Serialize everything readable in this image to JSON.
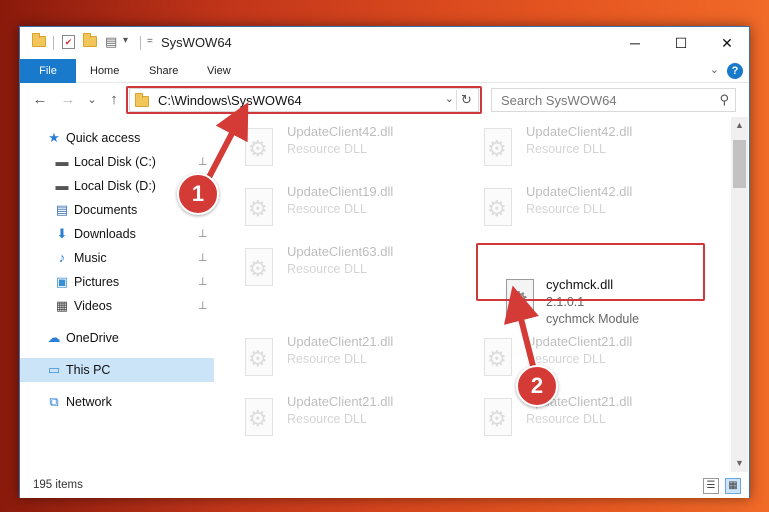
{
  "window": {
    "title": "SysWOW64",
    "minimize_glyph": "─",
    "maximize_glyph": "☐",
    "close_glyph": "✕"
  },
  "quick_access_toolbar": {
    "icons": [
      "folder-icon",
      "properties-icon",
      "new-folder-icon",
      "customize-icon"
    ],
    "dropdown_glyph": "▾"
  },
  "ribbon": {
    "tabs": [
      "File",
      "Home",
      "Share",
      "View"
    ],
    "help_glyph": "?",
    "collapse_glyph": "⌄"
  },
  "navigation": {
    "back_glyph": "←",
    "forward_glyph": "→",
    "recent_glyph": "⌄",
    "up_glyph": "↑",
    "address": "C:\\Windows\\SysWOW64",
    "address_dropdown_glyph": "⌄",
    "refresh_glyph": "↻",
    "search_placeholder": "Search SysWOW64",
    "search_glyph": "⚲"
  },
  "sidebar": {
    "items": [
      {
        "label": "Quick access",
        "icon": "star-icon",
        "glyph": "★",
        "color": "#2a7fd4",
        "pinned": false
      },
      {
        "label": "Local Disk (C:)",
        "icon": "drive-icon",
        "glyph": "▬",
        "color": "#555555",
        "pinned": true
      },
      {
        "label": "Local Disk (D:)",
        "icon": "drive-icon",
        "glyph": "▬",
        "color": "#555555",
        "pinned": false
      },
      {
        "label": "Documents",
        "icon": "documents-icon",
        "glyph": "▤",
        "color": "#3a6fb0",
        "pinned": true
      },
      {
        "label": "Downloads",
        "icon": "download-icon",
        "glyph": "⬇",
        "color": "#2a7fd4",
        "pinned": true
      },
      {
        "label": "Music",
        "icon": "music-icon",
        "glyph": "♪",
        "color": "#2a7fd4",
        "pinned": true
      },
      {
        "label": "Pictures",
        "icon": "pictures-icon",
        "glyph": "▣",
        "color": "#3a8fd4",
        "pinned": true
      },
      {
        "label": "Videos",
        "icon": "videos-icon",
        "glyph": "▦",
        "color": "#444444",
        "pinned": true
      },
      {
        "label": "OneDrive",
        "icon": "cloud-icon",
        "glyph": "☁",
        "color": "#2a7fd4",
        "pinned": false
      },
      {
        "label": "This PC",
        "icon": "computer-icon",
        "glyph": "▭",
        "color": "#3a8fd4",
        "pinned": false,
        "selected": true
      },
      {
        "label": "Network",
        "icon": "network-icon",
        "glyph": "⧉",
        "color": "#2a7fd4",
        "pinned": false
      }
    ],
    "pin_glyph": "📌"
  },
  "files": [
    {
      "name": "UpdateClient42.dll",
      "line2": "Resource DLL",
      "line3": "",
      "faded": true
    },
    {
      "name": "UpdateClient42.dll",
      "line2": "Resource DLL",
      "line3": "",
      "faded": true
    },
    {
      "name": "UpdateClient19.dll",
      "line2": "Resource DLL",
      "line3": "",
      "faded": true
    },
    {
      "name": "UpdateClient42.dll",
      "line2": "Resource DLL",
      "line3": "",
      "faded": true
    },
    {
      "name": "UpdateClient63.dll",
      "line2": "Resource DLL",
      "line3": "",
      "faded": true
    },
    {
      "name": "cychmck.dll",
      "line2": "2.1.0.1",
      "line3": "cychmck Module",
      "faded": false
    },
    {
      "name": "UpdateClient21.dll",
      "line2": "Resource DLL",
      "line3": "",
      "faded": true
    },
    {
      "name": "UpdateClient21.dll",
      "line2": "Resource DLL",
      "line3": "",
      "faded": true
    },
    {
      "name": "UpdateClient21.dll",
      "line2": "Resource DLL",
      "line3": "",
      "faded": true
    },
    {
      "name": "UpdateClient21.dll",
      "line2": "Resource DLL",
      "line3": "",
      "faded": true
    }
  ],
  "file_icon_glyph": "⚙",
  "scrollbar": {
    "up_glyph": "▲",
    "down_glyph": "▼"
  },
  "status": {
    "item_count": "195 items",
    "details_view_glyph": "☰",
    "large_icons_glyph": "▦"
  },
  "callouts": [
    {
      "number": "1",
      "color": "#d43a36"
    },
    {
      "number": "2",
      "color": "#d43a36"
    }
  ],
  "highlight_color": "#d0373a"
}
